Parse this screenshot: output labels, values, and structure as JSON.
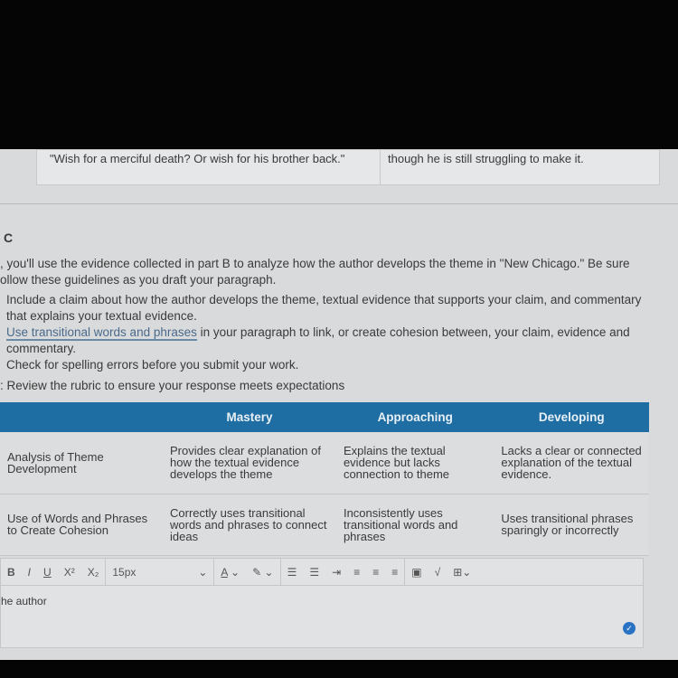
{
  "evidence": {
    "quote": "\"Wish for a merciful death? Or wish for his brother back.\"",
    "response": "though he is still struggling to make it."
  },
  "part_label": "C",
  "intro": ", you'll use the evidence collected in part B to analyze how the author develops the theme in \"New Chicago.\" Be sure ollow these guidelines as you draft your paragraph.",
  "guidelines": {
    "item1": "Include a claim about how the author develops the theme, textual evidence that supports your claim, and commentary that explains your textual evidence.",
    "item2_link": "Use transitional words and phrases",
    "item2_rest": " in your paragraph to link, or create cohesion between, your claim, evidence and commentary.",
    "item3": "Check for spelling errors before you submit your work."
  },
  "tip": ": Review the rubric to ensure your response meets expectations",
  "rubric": {
    "headers": [
      "",
      "Mastery",
      "Approaching",
      "Developing"
    ],
    "rows": [
      [
        "Analysis of Theme Development",
        "Provides clear explanation of how the textual evidence develops the theme",
        "Explains the textual evidence but lacks connection to theme",
        "Lacks a clear or connected explanation of the textual evidence."
      ],
      [
        "Use of Words and Phrases to Create Cohesion",
        "Correctly uses transitional words and phrases to connect ideas",
        "Inconsistently uses transitional words and phrases",
        "Uses transitional phrases sparingly or incorrectly"
      ]
    ]
  },
  "editor": {
    "font_size": "15px",
    "content": "he author",
    "icons": [
      "bold",
      "italic",
      "underline",
      "superscript",
      "subscript",
      "font-size-select",
      "font-color",
      "highlight",
      "bullet-list",
      "numbered-list",
      "indent",
      "align-left",
      "align-center",
      "align-right",
      "image",
      "spellcheck",
      "table"
    ]
  },
  "colors": {
    "header": "#1f6ea3",
    "link": "#4a6a8a"
  }
}
